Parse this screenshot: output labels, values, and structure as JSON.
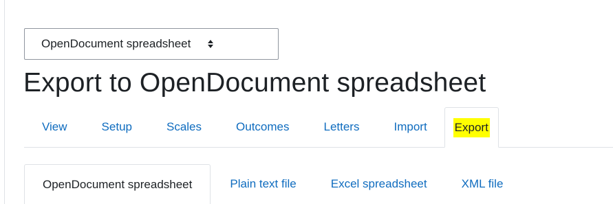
{
  "format_select": {
    "selected": "OpenDocument spreadsheet",
    "icon": "updown-arrows-icon"
  },
  "page": {
    "title": "Export to OpenDocument spreadsheet"
  },
  "primary_tabs": [
    {
      "label": "View",
      "active": false
    },
    {
      "label": "Setup",
      "active": false
    },
    {
      "label": "Scales",
      "active": false
    },
    {
      "label": "Outcomes",
      "active": false
    },
    {
      "label": "Letters",
      "active": false
    },
    {
      "label": "Import",
      "active": false
    },
    {
      "label": "Export",
      "active": true,
      "highlight": "#ffff00"
    }
  ],
  "secondary_tabs": [
    {
      "label": "OpenDocument spreadsheet",
      "active": true
    },
    {
      "label": "Plain text file",
      "active": false
    },
    {
      "label": "Excel spreadsheet",
      "active": false
    },
    {
      "label": "XML file",
      "active": false
    }
  ],
  "colors": {
    "link": "#0f6cbf",
    "text": "#1d2125",
    "border": "#dee2e6",
    "highlight": "#ffff00"
  }
}
